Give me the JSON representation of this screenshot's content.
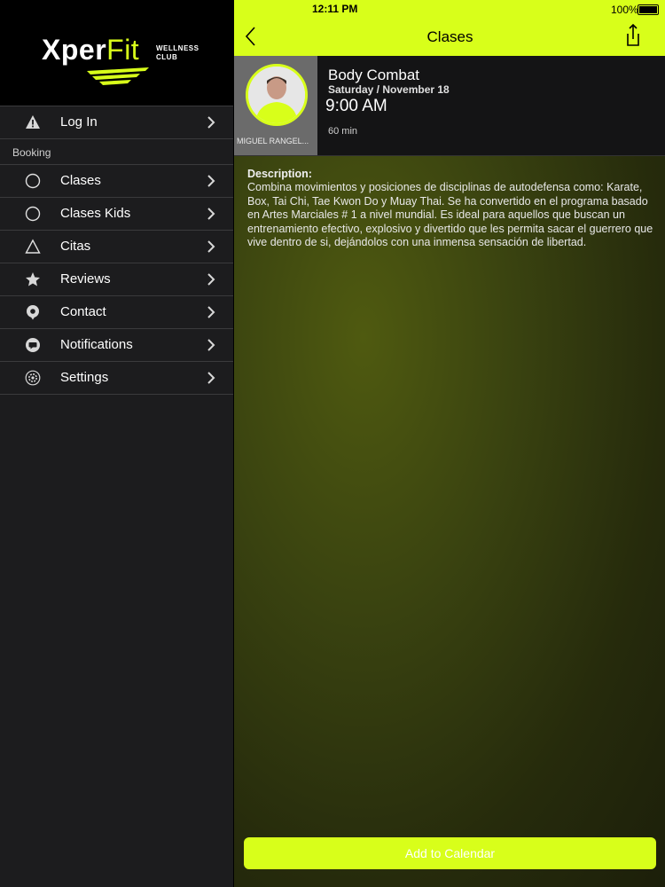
{
  "status_bar": {
    "time": "12:11 PM",
    "battery": "100%"
  },
  "sidebar": {
    "logo": {
      "brand_main": "Xper",
      "brand_accent": "Fit",
      "sub_line1": "WELLNESS",
      "sub_line2": "CLUB"
    },
    "login": {
      "label": "Log In",
      "icon": "warning-icon"
    },
    "section_label": "Booking",
    "items": [
      {
        "label": "Clases",
        "icon": "circle-icon"
      },
      {
        "label": "Clases Kids",
        "icon": "circle-icon"
      },
      {
        "label": "Citas",
        "icon": "triangle-icon"
      },
      {
        "label": "Reviews",
        "icon": "star-icon"
      },
      {
        "label": "Contact",
        "icon": "location-pin-icon"
      },
      {
        "label": "Notifications",
        "icon": "chat-bubble-icon"
      },
      {
        "label": "Settings",
        "icon": "gear-icon"
      }
    ]
  },
  "navbar": {
    "title": "Clases"
  },
  "class_detail": {
    "name": "Body Combat",
    "date": "Saturday / November 18",
    "time": "9:00 AM",
    "duration": "60 min",
    "instructor": "MIGUEL RANGEL..."
  },
  "description": {
    "title": "Description:",
    "text": "Combina movimientos y posiciones de disciplinas de autodefensa como: Karate, Box, Tai Chi, Tae Kwon Do y Muay Thai. Se ha convertido en el programa basado en Artes Marciales # 1 a nivel mundial. Es ideal para aquellos que buscan un entrenamiento efectivo, explosivo y divertido que les permita sacar el guerrero que vive dentro de si, dejándolos con una inmensa sensación de libertad."
  },
  "add_button": {
    "label": "Add to Calendar"
  },
  "colors": {
    "accent": "#d8ff1a",
    "sidebar_bg": "#1c1c1e",
    "logo_bg": "#000000"
  }
}
